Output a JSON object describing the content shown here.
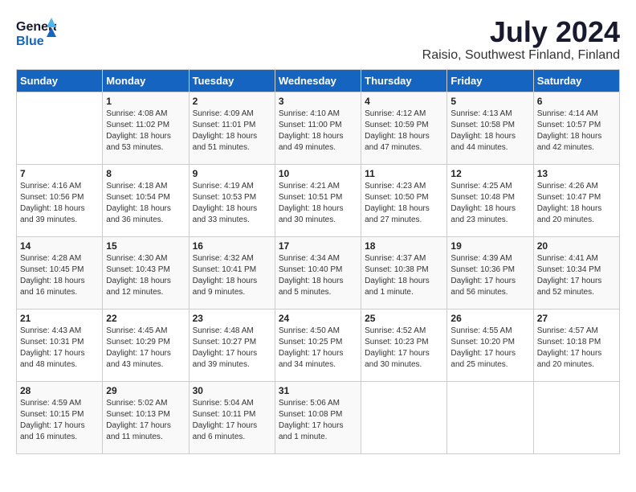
{
  "logo": {
    "general": "General",
    "blue": "Blue"
  },
  "title": {
    "month_year": "July 2024",
    "location": "Raisio, Southwest Finland, Finland"
  },
  "days_of_week": [
    "Sunday",
    "Monday",
    "Tuesday",
    "Wednesday",
    "Thursday",
    "Friday",
    "Saturday"
  ],
  "weeks": [
    [
      {
        "day": "",
        "content": ""
      },
      {
        "day": "1",
        "content": "Sunrise: 4:08 AM\nSunset: 11:02 PM\nDaylight: 18 hours\nand 53 minutes."
      },
      {
        "day": "2",
        "content": "Sunrise: 4:09 AM\nSunset: 11:01 PM\nDaylight: 18 hours\nand 51 minutes."
      },
      {
        "day": "3",
        "content": "Sunrise: 4:10 AM\nSunset: 11:00 PM\nDaylight: 18 hours\nand 49 minutes."
      },
      {
        "day": "4",
        "content": "Sunrise: 4:12 AM\nSunset: 10:59 PM\nDaylight: 18 hours\nand 47 minutes."
      },
      {
        "day": "5",
        "content": "Sunrise: 4:13 AM\nSunset: 10:58 PM\nDaylight: 18 hours\nand 44 minutes."
      },
      {
        "day": "6",
        "content": "Sunrise: 4:14 AM\nSunset: 10:57 PM\nDaylight: 18 hours\nand 42 minutes."
      }
    ],
    [
      {
        "day": "7",
        "content": "Sunrise: 4:16 AM\nSunset: 10:56 PM\nDaylight: 18 hours\nand 39 minutes."
      },
      {
        "day": "8",
        "content": "Sunrise: 4:18 AM\nSunset: 10:54 PM\nDaylight: 18 hours\nand 36 minutes."
      },
      {
        "day": "9",
        "content": "Sunrise: 4:19 AM\nSunset: 10:53 PM\nDaylight: 18 hours\nand 33 minutes."
      },
      {
        "day": "10",
        "content": "Sunrise: 4:21 AM\nSunset: 10:51 PM\nDaylight: 18 hours\nand 30 minutes."
      },
      {
        "day": "11",
        "content": "Sunrise: 4:23 AM\nSunset: 10:50 PM\nDaylight: 18 hours\nand 27 minutes."
      },
      {
        "day": "12",
        "content": "Sunrise: 4:25 AM\nSunset: 10:48 PM\nDaylight: 18 hours\nand 23 minutes."
      },
      {
        "day": "13",
        "content": "Sunrise: 4:26 AM\nSunset: 10:47 PM\nDaylight: 18 hours\nand 20 minutes."
      }
    ],
    [
      {
        "day": "14",
        "content": "Sunrise: 4:28 AM\nSunset: 10:45 PM\nDaylight: 18 hours\nand 16 minutes."
      },
      {
        "day": "15",
        "content": "Sunrise: 4:30 AM\nSunset: 10:43 PM\nDaylight: 18 hours\nand 12 minutes."
      },
      {
        "day": "16",
        "content": "Sunrise: 4:32 AM\nSunset: 10:41 PM\nDaylight: 18 hours\nand 9 minutes."
      },
      {
        "day": "17",
        "content": "Sunrise: 4:34 AM\nSunset: 10:40 PM\nDaylight: 18 hours\nand 5 minutes."
      },
      {
        "day": "18",
        "content": "Sunrise: 4:37 AM\nSunset: 10:38 PM\nDaylight: 18 hours\nand 1 minute."
      },
      {
        "day": "19",
        "content": "Sunrise: 4:39 AM\nSunset: 10:36 PM\nDaylight: 17 hours\nand 56 minutes."
      },
      {
        "day": "20",
        "content": "Sunrise: 4:41 AM\nSunset: 10:34 PM\nDaylight: 17 hours\nand 52 minutes."
      }
    ],
    [
      {
        "day": "21",
        "content": "Sunrise: 4:43 AM\nSunset: 10:31 PM\nDaylight: 17 hours\nand 48 minutes."
      },
      {
        "day": "22",
        "content": "Sunrise: 4:45 AM\nSunset: 10:29 PM\nDaylight: 17 hours\nand 43 minutes."
      },
      {
        "day": "23",
        "content": "Sunrise: 4:48 AM\nSunset: 10:27 PM\nDaylight: 17 hours\nand 39 minutes."
      },
      {
        "day": "24",
        "content": "Sunrise: 4:50 AM\nSunset: 10:25 PM\nDaylight: 17 hours\nand 34 minutes."
      },
      {
        "day": "25",
        "content": "Sunrise: 4:52 AM\nSunset: 10:23 PM\nDaylight: 17 hours\nand 30 minutes."
      },
      {
        "day": "26",
        "content": "Sunrise: 4:55 AM\nSunset: 10:20 PM\nDaylight: 17 hours\nand 25 minutes."
      },
      {
        "day": "27",
        "content": "Sunrise: 4:57 AM\nSunset: 10:18 PM\nDaylight: 17 hours\nand 20 minutes."
      }
    ],
    [
      {
        "day": "28",
        "content": "Sunrise: 4:59 AM\nSunset: 10:15 PM\nDaylight: 17 hours\nand 16 minutes."
      },
      {
        "day": "29",
        "content": "Sunrise: 5:02 AM\nSunset: 10:13 PM\nDaylight: 17 hours\nand 11 minutes."
      },
      {
        "day": "30",
        "content": "Sunrise: 5:04 AM\nSunset: 10:11 PM\nDaylight: 17 hours\nand 6 minutes."
      },
      {
        "day": "31",
        "content": "Sunrise: 5:06 AM\nSunset: 10:08 PM\nDaylight: 17 hours\nand 1 minute."
      },
      {
        "day": "",
        "content": ""
      },
      {
        "day": "",
        "content": ""
      },
      {
        "day": "",
        "content": ""
      }
    ]
  ]
}
